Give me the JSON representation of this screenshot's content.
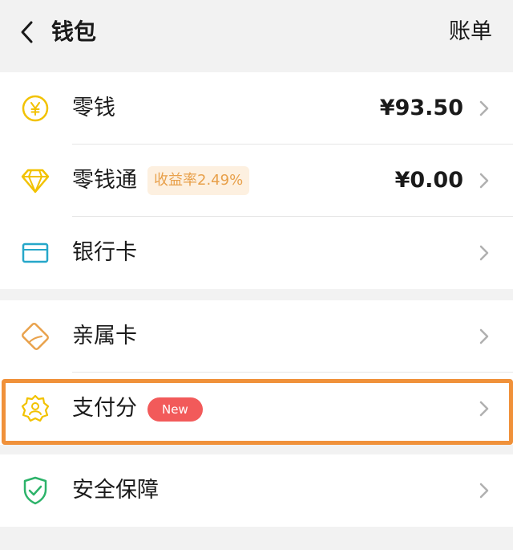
{
  "header": {
    "title": "钱包",
    "bill_label": "账单"
  },
  "group1": {
    "change": {
      "label": "零钱",
      "amount": "¥93.50"
    },
    "change_pass": {
      "label": "零钱通",
      "badge": "收益率2.49%",
      "amount": "¥0.00"
    },
    "bank_card": {
      "label": "银行卡"
    }
  },
  "group2": {
    "family_card": {
      "label": "亲属卡"
    },
    "pay_score": {
      "label": "支付分",
      "badge": "New"
    }
  },
  "group3": {
    "security": {
      "label": "安全保障"
    }
  },
  "colors": {
    "yellow_icon": "#f2c200",
    "blue_icon": "#26a7c9",
    "orange_icon": "#e9a24c",
    "green_icon": "#2db36a",
    "highlight": "#f0913a",
    "new_badge": "#f25a5a"
  },
  "icons": [
    "back-arrow-icon",
    "yen-coin-icon",
    "diamond-icon",
    "bank-card-icon",
    "family-card-icon",
    "pay-score-badge-icon",
    "shield-check-icon",
    "chevron-right-icon"
  ]
}
